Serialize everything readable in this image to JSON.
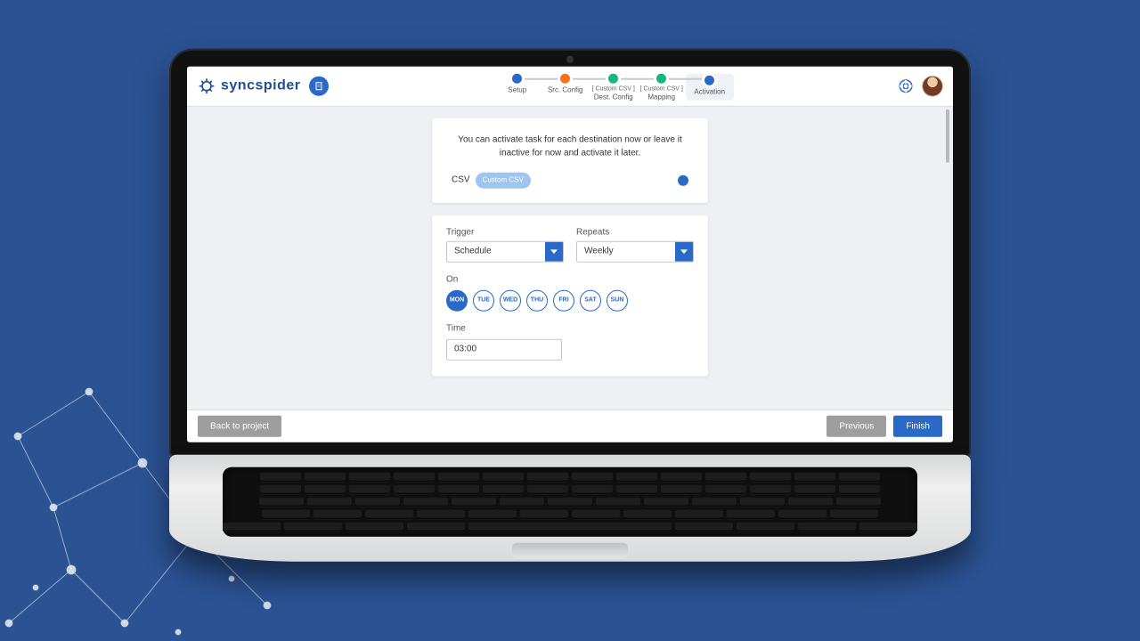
{
  "brand": {
    "name": "syncspider"
  },
  "stepper": {
    "steps": [
      {
        "label": "Setup",
        "sub": "",
        "color": "#2a69c8"
      },
      {
        "label": "Src. Config",
        "sub": "",
        "color": "#f97316"
      },
      {
        "label": "Dest. Config",
        "sub": "[ Custom CSV ]",
        "color": "#10b981"
      },
      {
        "label": "Mapping",
        "sub": "[ Custom CSV ]",
        "color": "#10b981"
      },
      {
        "label": "Activation",
        "sub": "",
        "color": "#2a69c8"
      }
    ],
    "activeIndex": 4
  },
  "intro": {
    "text": "You can activate task for each destination now or leave it inactive for now and activate it later.",
    "destLabel": "CSV",
    "chip": "Custom CSV",
    "toggleOn": true
  },
  "schedule": {
    "triggerLabel": "Trigger",
    "triggerValue": "Schedule",
    "repeatsLabel": "Repeats",
    "repeatsValue": "Weekly",
    "onLabel": "On",
    "days": [
      {
        "abbr": "MON",
        "selected": true
      },
      {
        "abbr": "TUE",
        "selected": false
      },
      {
        "abbr": "WED",
        "selected": false
      },
      {
        "abbr": "THU",
        "selected": false
      },
      {
        "abbr": "FRI",
        "selected": false
      },
      {
        "abbr": "SAT",
        "selected": false
      },
      {
        "abbr": "SUN",
        "selected": false
      }
    ],
    "timeLabel": "Time",
    "timeValue": "03:00"
  },
  "footer": {
    "back": "Back to project",
    "previous": "Previous",
    "finish": "Finish"
  }
}
